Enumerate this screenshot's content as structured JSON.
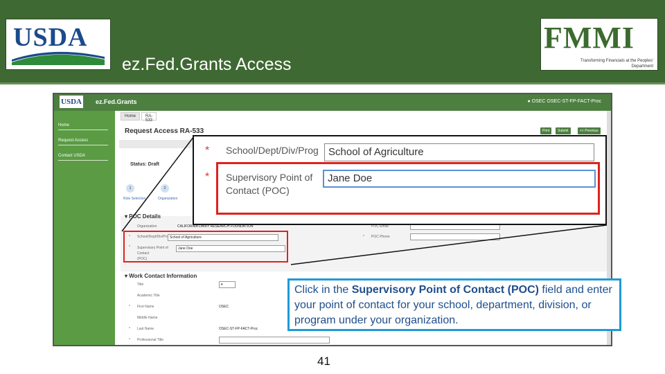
{
  "banner": {
    "usda_logo": "USDA",
    "title": "ez.Fed.Grants Access",
    "fmmi_logo": "FMMI",
    "fmmi_tagline": "Transforming Financials at the Peoples' Department"
  },
  "app": {
    "logo": "USDA",
    "name": "ez.Fed.Grants",
    "user": "OSEC OSEC-ST-FP-FACT-Proc",
    "sidebar": [
      "Home",
      "Request Access",
      "Contact USDA"
    ],
    "tabs": [
      "Home",
      "RA-533"
    ],
    "page_title": "Request Access RA-533",
    "buttons": [
      "Print",
      "Submit",
      "<< Previous"
    ],
    "status": "Status: Draft",
    "steps": [
      {
        "num": "1",
        "label": "Role Selection"
      },
      {
        "num": "2",
        "label": "Organization"
      }
    ],
    "poc_section": "POC Details",
    "poc_fields": {
      "organization_label": "Organization",
      "organization_value": "CALIFORNIA DAIRY RESEARCH FOUNDATION",
      "school_label": "School/Dept/Div/Prog",
      "school_value": "School of Agriculture",
      "sup_label_1": "Supervisory Point of",
      "sup_label_2": "Contact",
      "sup_label_3": "(POC)",
      "sup_value": "Jane Doe",
      "poc_email_label": "POC Email",
      "poc_phone_label": "POC Phone"
    },
    "work_section": "Work Contact Information",
    "work_fields": [
      {
        "label": "Title",
        "value": ""
      },
      {
        "label": "Academic Title",
        "value": ""
      },
      {
        "label": "First Name",
        "value": "OSEC"
      },
      {
        "label": "Middle Name",
        "value": ""
      },
      {
        "label": "Last Name",
        "value": "OSEC-ST-FP-FACT-Proc"
      },
      {
        "label": "Professional Title",
        "value": ""
      }
    ]
  },
  "zoom": {
    "school_label": "School/Dept/Div/Prog",
    "school_value": "School of Agriculture",
    "sup_label": "Supervisory Point of Contact (POC)",
    "sup_value": "Jane Doe"
  },
  "instruction": {
    "part1": "Click in the ",
    "bold": "Supervisory Point of Contact (POC)",
    "part2": " field and enter your point of contact for your school, department, division, or program under your organization."
  },
  "page_number": "41"
}
